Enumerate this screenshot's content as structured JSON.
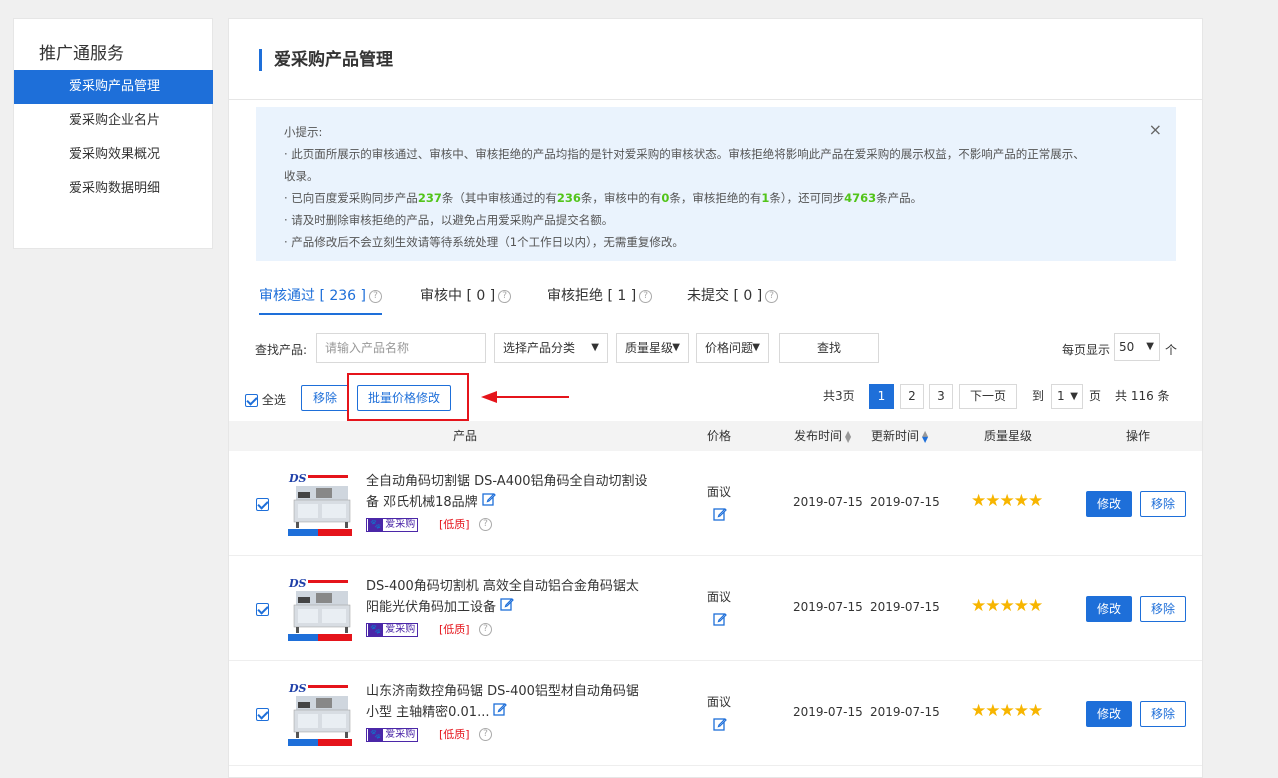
{
  "sidebar": {
    "title": "推广通服务",
    "items": [
      {
        "label": "爱采购产品管理",
        "active": true
      },
      {
        "label": "爱采购企业名片",
        "active": false
      },
      {
        "label": "爱采购效果概况",
        "active": false
      },
      {
        "label": "爱采购数据明细",
        "active": false
      }
    ]
  },
  "page": {
    "title": "爱采购产品管理"
  },
  "tips": {
    "heading": "小提示:",
    "line1": "· 此页面所展示的审核通过、审核中、审核拒绝的产品均指的是针对爱采购的审核状态。审核拒绝将影响此产品在爱采购的展示权益，不影响产品的正常展示、",
    "line1b": "收录。",
    "line2": {
      "p1": "· 已向百度爱采购同步产品",
      "n1": "237",
      "p2": "条（其中审核通过的有",
      "n2": "236",
      "p3": "条，审核中的有",
      "n3": "0",
      "p4": "条，审核拒绝的有",
      "n4": "1",
      "p5": "条），还可同步",
      "n5": "4763",
      "p6": "条产品。"
    },
    "line3": "· 请及时删除审核拒绝的产品，以避免占用爱采购产品提交名额。",
    "line4": "· 产品修改后不会立刻生效请等待系统处理（1个工作日以内），无需重复修改。",
    "close": "×"
  },
  "tabs": [
    {
      "label": "审核通过 [ 236 ]",
      "active": true
    },
    {
      "label": "审核中 [ 0 ]",
      "active": false
    },
    {
      "label": "审核拒绝 [ 1 ]",
      "active": false
    },
    {
      "label": "未提交 [ 0 ]",
      "active": false
    }
  ],
  "filter": {
    "label": "查找产品:",
    "placeholder": "请输入产品名称",
    "category": "选择产品分类",
    "quality": "质量星级",
    "price_issue": "价格问题",
    "search": "查找",
    "per_page_label": "每页显示",
    "per_page": "50",
    "per_page_unit": "个"
  },
  "actions": {
    "select_all": "全选",
    "remove": "移除",
    "batch_price": "批量价格修改"
  },
  "pager": {
    "total_pages": "共3页",
    "pages": [
      "1",
      "2",
      "3"
    ],
    "current": "1",
    "next": "下一页",
    "goto": "到",
    "goto_value": "1",
    "page_unit": "页",
    "total": "共 116 条"
  },
  "table": {
    "headers": {
      "product": "产品",
      "price": "价格",
      "publish": "发布时间",
      "update": "更新时间",
      "quality": "质量星级",
      "ops": "操作"
    },
    "rows": [
      {
        "title": "全自动角码切割锯 DS-A400铝角码全自动切割设备 邓氏机械18品牌",
        "badge": "爱采购",
        "low": "[低质]",
        "price": "面议",
        "publish": "2019-07-15",
        "update": "2019-07-15",
        "stars": "★★★★★",
        "edit": "修改",
        "remove": "移除"
      },
      {
        "title": "DS-400角码切割机 高效全自动铝合金角码锯太阳能光伏角码加工设备",
        "badge": "爱采购",
        "low": "[低质]",
        "price": "面议",
        "publish": "2019-07-15",
        "update": "2019-07-15",
        "stars": "★★★★★",
        "edit": "修改",
        "remove": "移除"
      },
      {
        "title": "山东济南数控角码锯 DS-400铝型材自动角码锯 小型 主轴精密0.01...",
        "badge": "爱采购",
        "low": "[低质]",
        "price": "面议",
        "publish": "2019-07-15",
        "update": "2019-07-15",
        "stars": "★★★★★",
        "edit": "修改",
        "remove": "移除"
      }
    ]
  },
  "colors": {
    "primary": "#1e6fd9",
    "highlight": "#e5141b",
    "green": "#52c41a",
    "star": "#f7b500",
    "badge": "#4b27a8"
  }
}
